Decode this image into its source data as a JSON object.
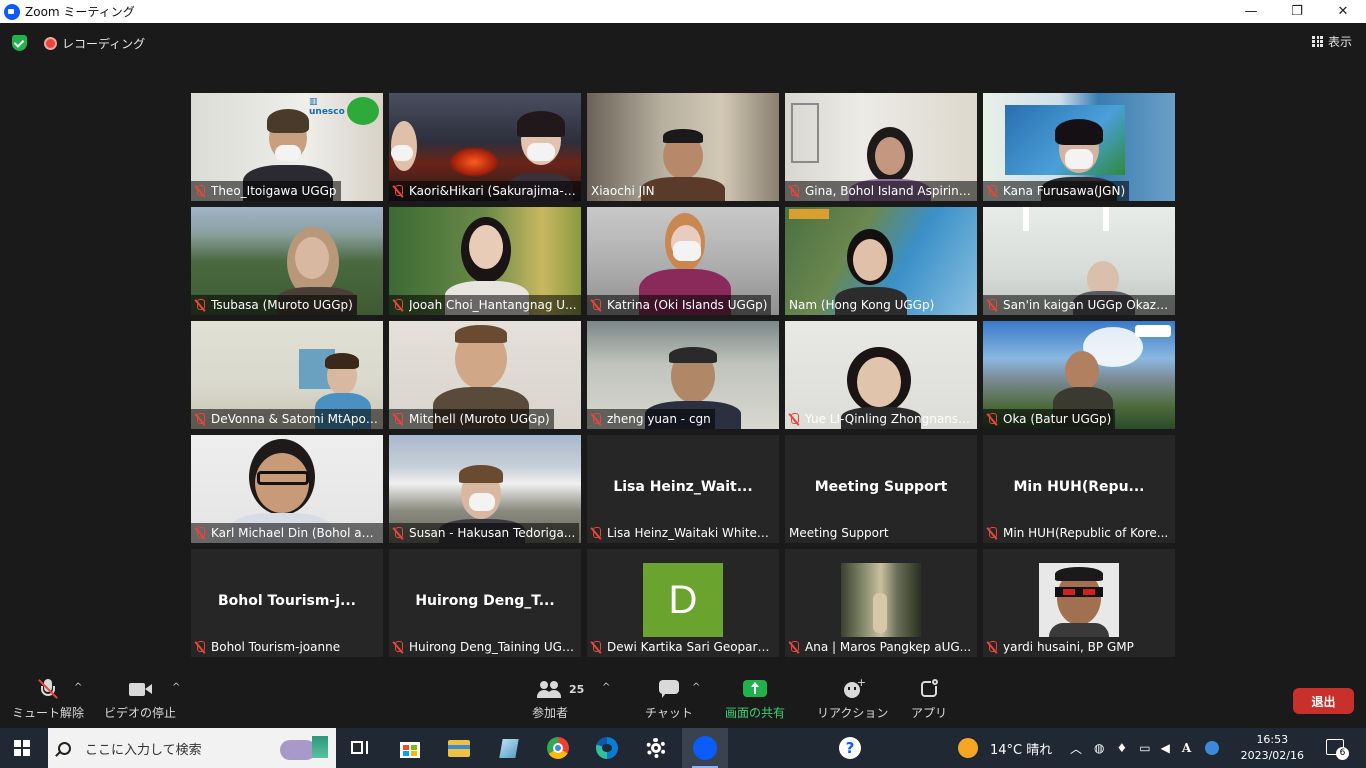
{
  "window": {
    "title": "Zoom ミーティング",
    "minimize": "—",
    "restore": "❐",
    "close": "✕"
  },
  "topbar": {
    "recording_label": "レコーディング",
    "view_label": "表示"
  },
  "participants": [
    {
      "name": "Theo_Itoigawa UGGp",
      "muted": true,
      "video": true
    },
    {
      "name": "Kaori&Hikari (Sakurajima-K...",
      "muted": true,
      "video": true
    },
    {
      "name": "Xiaochi JIN",
      "muted": false,
      "video": true,
      "active_speaker": true
    },
    {
      "name": "Gina, Bohol Island Aspiring...",
      "muted": true,
      "video": true
    },
    {
      "name": "Kana Furusawa(JGN)",
      "muted": true,
      "video": true
    },
    {
      "name": "Tsubasa (Muroto UGGp)",
      "muted": true,
      "video": true
    },
    {
      "name": "Jooah Choi_Hantangnag U...",
      "muted": true,
      "video": true
    },
    {
      "name": "Katrina (Oki Islands UGGp)",
      "muted": true,
      "video": true
    },
    {
      "name": "Nam (Hong Kong UGGp)",
      "muted": false,
      "video": true
    },
    {
      "name": "San'in kaigan UGGp Okazaki",
      "muted": true,
      "video": true
    },
    {
      "name": "DeVonna & Satomi MtApoi...",
      "muted": true,
      "video": true
    },
    {
      "name": "Mitchell (Muroto UGGp)",
      "muted": true,
      "video": true
    },
    {
      "name": "zheng yuan - cgn",
      "muted": true,
      "video": true
    },
    {
      "name": "Yue LI-Qinling Zhongnansh...",
      "muted": true,
      "video": true
    },
    {
      "name": "Oka (Batur UGGp)",
      "muted": true,
      "video": true
    },
    {
      "name": "Karl Michael Din (Bohol aU...",
      "muted": true,
      "video": true
    },
    {
      "name": "Susan - Hakusan Tedoriga...",
      "muted": true,
      "video": true
    },
    {
      "name": "Lisa Heinz_Waitaki Whitest...",
      "display_name": "Lisa  Heinz_Wait...",
      "muted": true,
      "video": false
    },
    {
      "name": "Meeting Support",
      "display_name": "Meeting Support",
      "muted": false,
      "video": false
    },
    {
      "name": "Min HUH(Republic of Kore...",
      "display_name": "Min  HUH(Repu...",
      "muted": true,
      "video": false
    },
    {
      "name": "Bohol Tourism-joanne",
      "display_name": "Bohol  Tourism-j...",
      "muted": true,
      "video": false
    },
    {
      "name": "Huirong Deng_Taining UGGp",
      "display_name": "Huirong  Deng_T...",
      "muted": true,
      "video": false
    },
    {
      "name": "Dewi Kartika Sari Geopark ...",
      "avatar_letter": "D",
      "muted": true,
      "video": false
    },
    {
      "name": "Ana | Maros Pangkep aUG...",
      "muted": true,
      "video": false
    },
    {
      "name": "yardi husaini, BP GMP",
      "muted": true,
      "video": false
    }
  ],
  "toolbar": {
    "mute_label": "ミュート解除",
    "video_label": "ビデオの停止",
    "participants_label": "参加者",
    "participants_count": "25",
    "chat_label": "チャット",
    "share_label": "画面の共有",
    "reaction_label": "リアクション",
    "apps_label": "アプリ",
    "leave_label": "退出",
    "caret": "^"
  },
  "taskbar": {
    "search_placeholder": "ここに入力して検索",
    "weather": "14°C  晴れ",
    "time": "16:53",
    "date": "2023/02/16",
    "notification_count": "6",
    "ime": "A"
  },
  "colors": {
    "active_speaker": "#d8e271",
    "muted_mic": "#e8453c",
    "share_green": "#22b14c",
    "leave_red": "#c9302c",
    "avatar_green": "#6ba32f"
  }
}
